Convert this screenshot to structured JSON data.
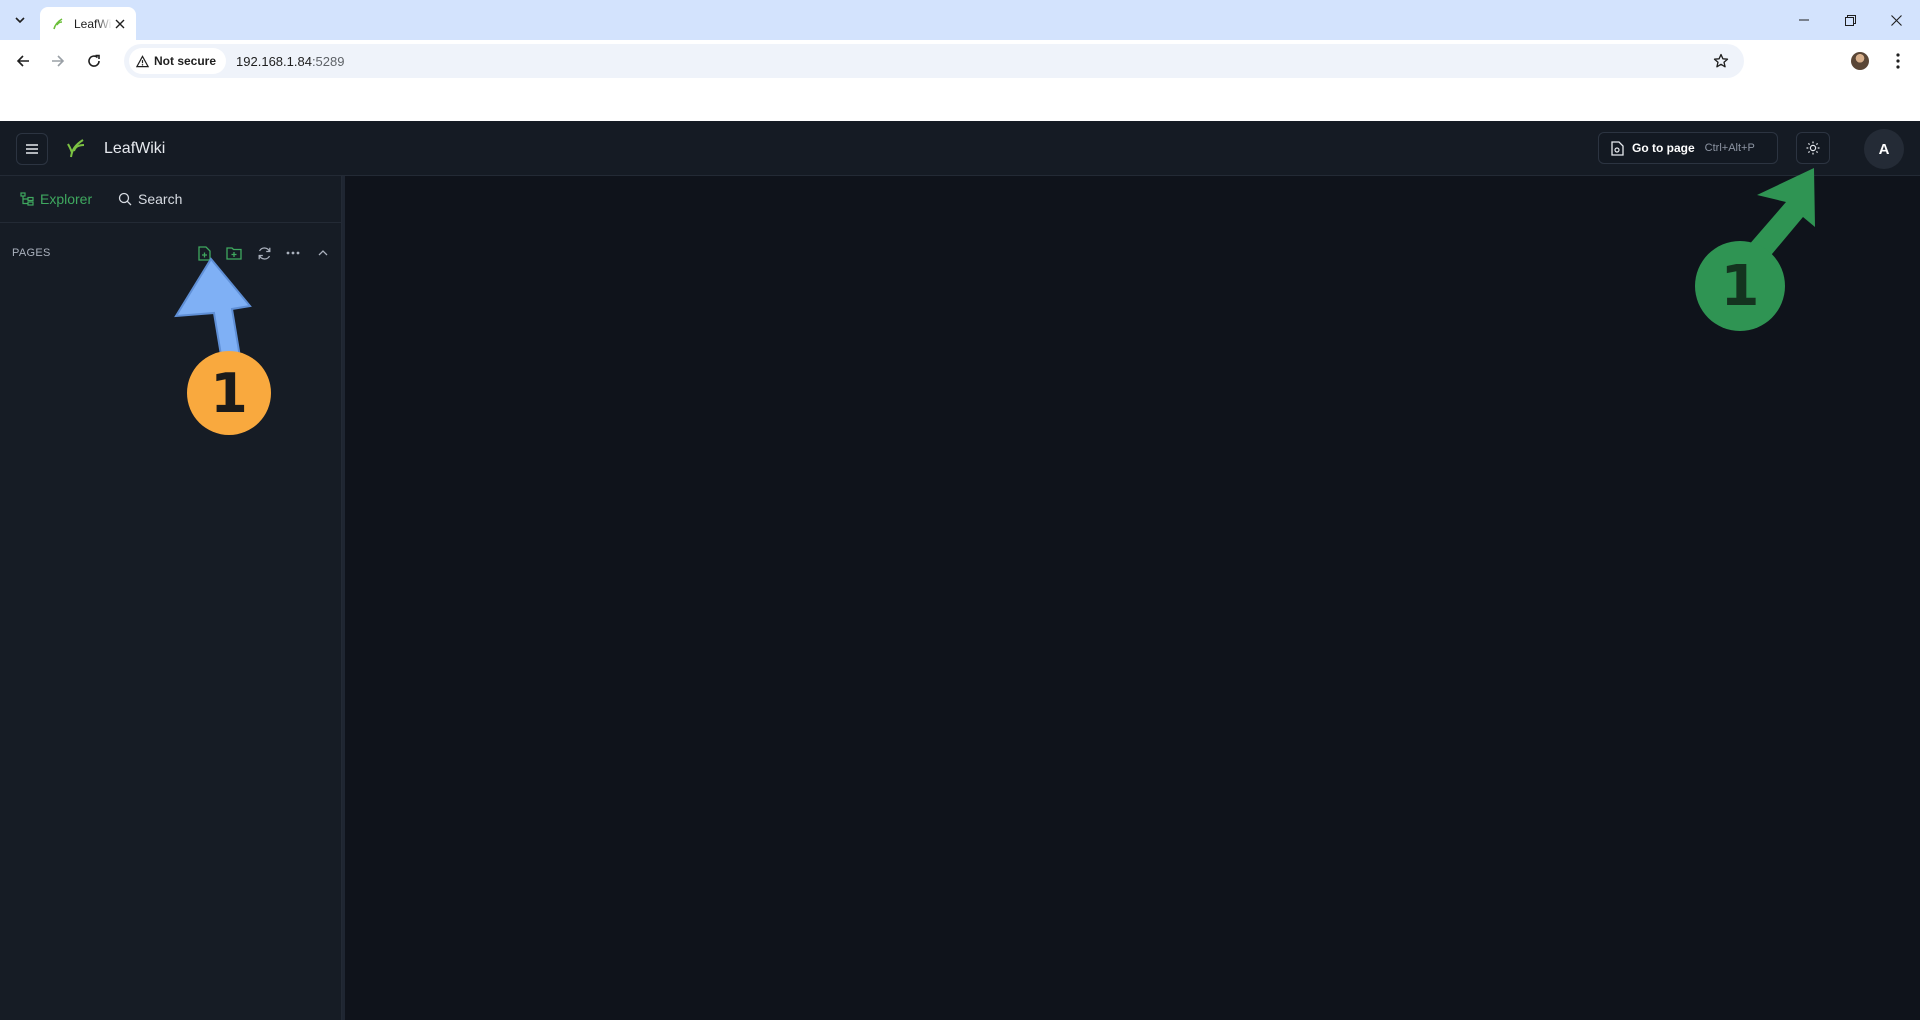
{
  "browser": {
    "tab_title": "LeafWiki",
    "security_chip": "Not secure",
    "url_host": "192.168.1.84",
    "url_port": ":5289"
  },
  "app": {
    "name": "LeafWiki",
    "goto_label": "Go to page",
    "goto_shortcut": "Ctrl+Alt+P",
    "avatar_initial": "A"
  },
  "sidebar": {
    "tabs": [
      {
        "label": "Explorer",
        "icon": "tree-icon",
        "active": true
      },
      {
        "label": "Search",
        "icon": "search-icon",
        "active": false
      }
    ],
    "section_label": "PAGES",
    "actions": [
      "new-page-icon",
      "new-folder-icon",
      "refresh-icon",
      "more-icon",
      "collapse-icon"
    ]
  },
  "annotations": [
    {
      "label": "1",
      "color": "#f9a93e",
      "arrow_color": "#7fb0f5",
      "target": "new-page-button"
    },
    {
      "label": "1",
      "color": "#2f9453",
      "arrow_color": "#2f9453",
      "target": "theme-toggle-button"
    }
  ],
  "colors": {
    "accent_green": "#3fa85f",
    "app_bg": "#0f131b",
    "header_bg": "#151b24",
    "sidebar_bg": "#161c25"
  }
}
